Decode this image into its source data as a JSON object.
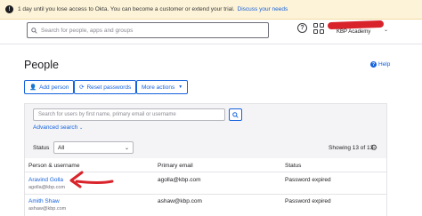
{
  "banner": {
    "icon": "warning-icon",
    "text": "1 day until you lose access to Okta. You can become a customer or extend your trial.",
    "link": "Discuss your needs"
  },
  "header": {
    "search_placeholder": "Search for people, apps and groups",
    "org_name": "KBP Academy",
    "icons": [
      "help-icon",
      "apps-grid-icon",
      "chevron-down-icon"
    ]
  },
  "page": {
    "title": "People",
    "help_link": "Help"
  },
  "actions": {
    "add_person": "Add person",
    "reset_passwords": "Reset passwords",
    "more_actions": "More actions"
  },
  "filters": {
    "search_placeholder": "Search for users by first name, primary email or username",
    "advanced_search": "Advanced search",
    "status_label": "Status",
    "status_value": "All",
    "showing": "Showing 13 of 13"
  },
  "table": {
    "columns": [
      "Person & username",
      "Primary email",
      "Status"
    ],
    "rows": [
      {
        "name": "Aravind Golla",
        "username": "agolla@kbp.com",
        "email": "agolla@kbp.com",
        "status": "Password expired"
      },
      {
        "name": "Amith Shaw",
        "username": "ashaw@kbp.com",
        "email": "ashaw@kbp.com",
        "status": "Password expired"
      }
    ]
  },
  "colors": {
    "accent": "#1662dd",
    "banner_bg": "#fdf3d8",
    "annotation_red": "#d9232b"
  }
}
